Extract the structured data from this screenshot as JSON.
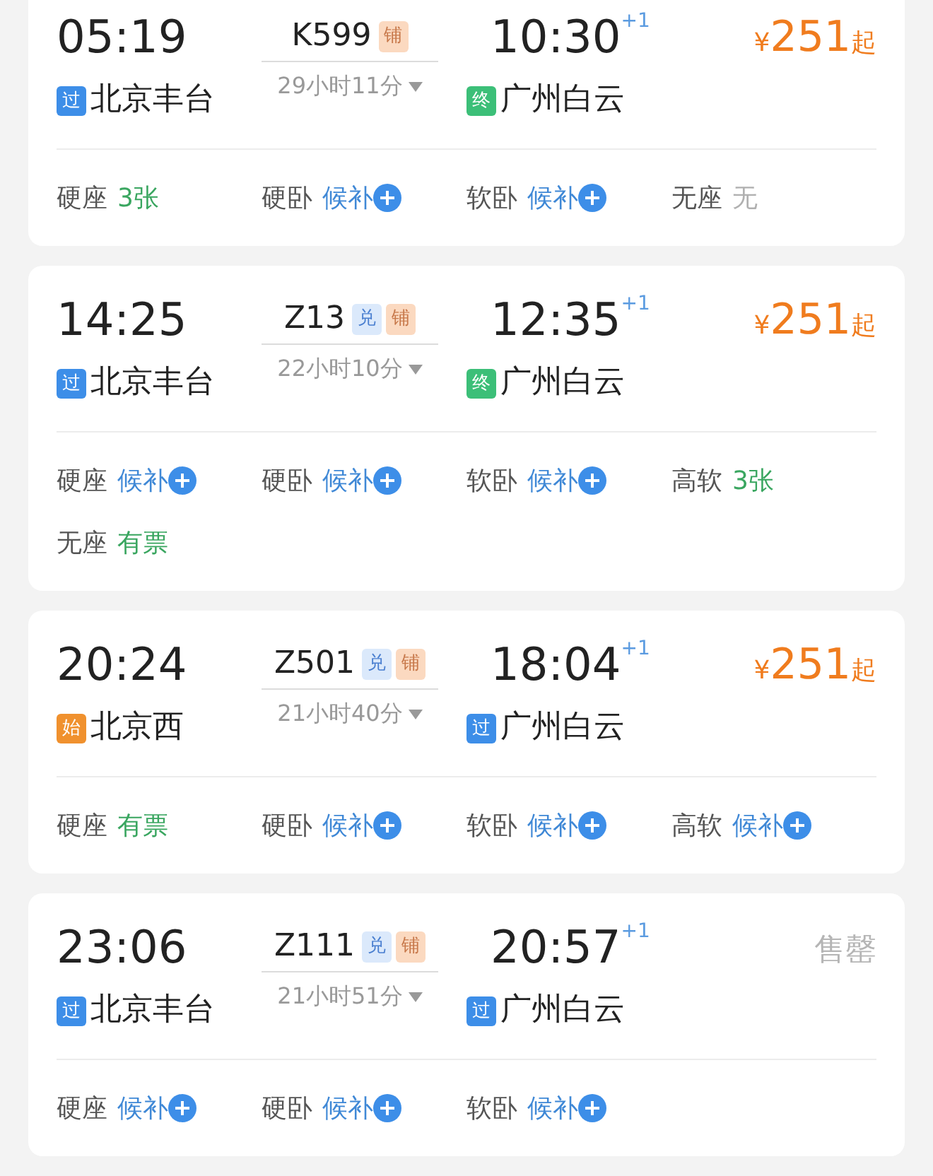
{
  "trains": [
    {
      "depart_time": "05:19",
      "depart_station": {
        "badge": "过",
        "kind": "pass",
        "name": "北京丰台"
      },
      "train_no": "K599",
      "tags": [
        {
          "text": "铺",
          "kind": "berth"
        }
      ],
      "duration": "29小时11分",
      "arrive_time": "10:30",
      "day_offset": "+1",
      "arrive_station": {
        "badge": "终",
        "kind": "end",
        "name": "广州白云"
      },
      "price": {
        "symbol": "¥",
        "amount": "251",
        "suffix": "起"
      },
      "seats": [
        {
          "name": "硬座",
          "availability": "3张",
          "kind": "available"
        },
        {
          "name": "硬卧",
          "availability": "候补",
          "kind": "waitlist"
        },
        {
          "name": "软卧",
          "availability": "候补",
          "kind": "waitlist"
        },
        {
          "name": "无座",
          "availability": "无",
          "kind": "none"
        }
      ]
    },
    {
      "depart_time": "14:25",
      "depart_station": {
        "badge": "过",
        "kind": "pass",
        "name": "北京丰台"
      },
      "train_no": "Z13",
      "tags": [
        {
          "text": "兑",
          "kind": "redeem"
        },
        {
          "text": "铺",
          "kind": "berth"
        }
      ],
      "duration": "22小时10分",
      "arrive_time": "12:35",
      "day_offset": "+1",
      "arrive_station": {
        "badge": "终",
        "kind": "end",
        "name": "广州白云"
      },
      "price": {
        "symbol": "¥",
        "amount": "251",
        "suffix": "起"
      },
      "seats": [
        {
          "name": "硬座",
          "availability": "候补",
          "kind": "waitlist"
        },
        {
          "name": "硬卧",
          "availability": "候补",
          "kind": "waitlist"
        },
        {
          "name": "软卧",
          "availability": "候补",
          "kind": "waitlist"
        },
        {
          "name": "高软",
          "availability": "3张",
          "kind": "available"
        },
        {
          "name": "无座",
          "availability": "有票",
          "kind": "available"
        }
      ]
    },
    {
      "depart_time": "20:24",
      "depart_station": {
        "badge": "始",
        "kind": "start",
        "name": "北京西"
      },
      "train_no": "Z501",
      "tags": [
        {
          "text": "兑",
          "kind": "redeem"
        },
        {
          "text": "铺",
          "kind": "berth"
        }
      ],
      "duration": "21小时40分",
      "arrive_time": "18:04",
      "day_offset": "+1",
      "arrive_station": {
        "badge": "过",
        "kind": "pass",
        "name": "广州白云"
      },
      "price": {
        "symbol": "¥",
        "amount": "251",
        "suffix": "起"
      },
      "seats": [
        {
          "name": "硬座",
          "availability": "有票",
          "kind": "available"
        },
        {
          "name": "硬卧",
          "availability": "候补",
          "kind": "waitlist"
        },
        {
          "name": "软卧",
          "availability": "候补",
          "kind": "waitlist"
        },
        {
          "name": "高软",
          "availability": "候补",
          "kind": "waitlist"
        }
      ]
    },
    {
      "depart_time": "23:06",
      "depart_station": {
        "badge": "过",
        "kind": "pass",
        "name": "北京丰台"
      },
      "train_no": "Z111",
      "tags": [
        {
          "text": "兑",
          "kind": "redeem"
        },
        {
          "text": "铺",
          "kind": "berth"
        }
      ],
      "duration": "21小时51分",
      "arrive_time": "20:57",
      "day_offset": "+1",
      "arrive_station": {
        "badge": "过",
        "kind": "pass",
        "name": "广州白云"
      },
      "status": "售罄",
      "seats": [
        {
          "name": "硬座",
          "availability": "候补",
          "kind": "waitlist"
        },
        {
          "name": "硬卧",
          "availability": "候补",
          "kind": "waitlist"
        },
        {
          "name": "软卧",
          "availability": "候补",
          "kind": "waitlist"
        }
      ]
    }
  ]
}
